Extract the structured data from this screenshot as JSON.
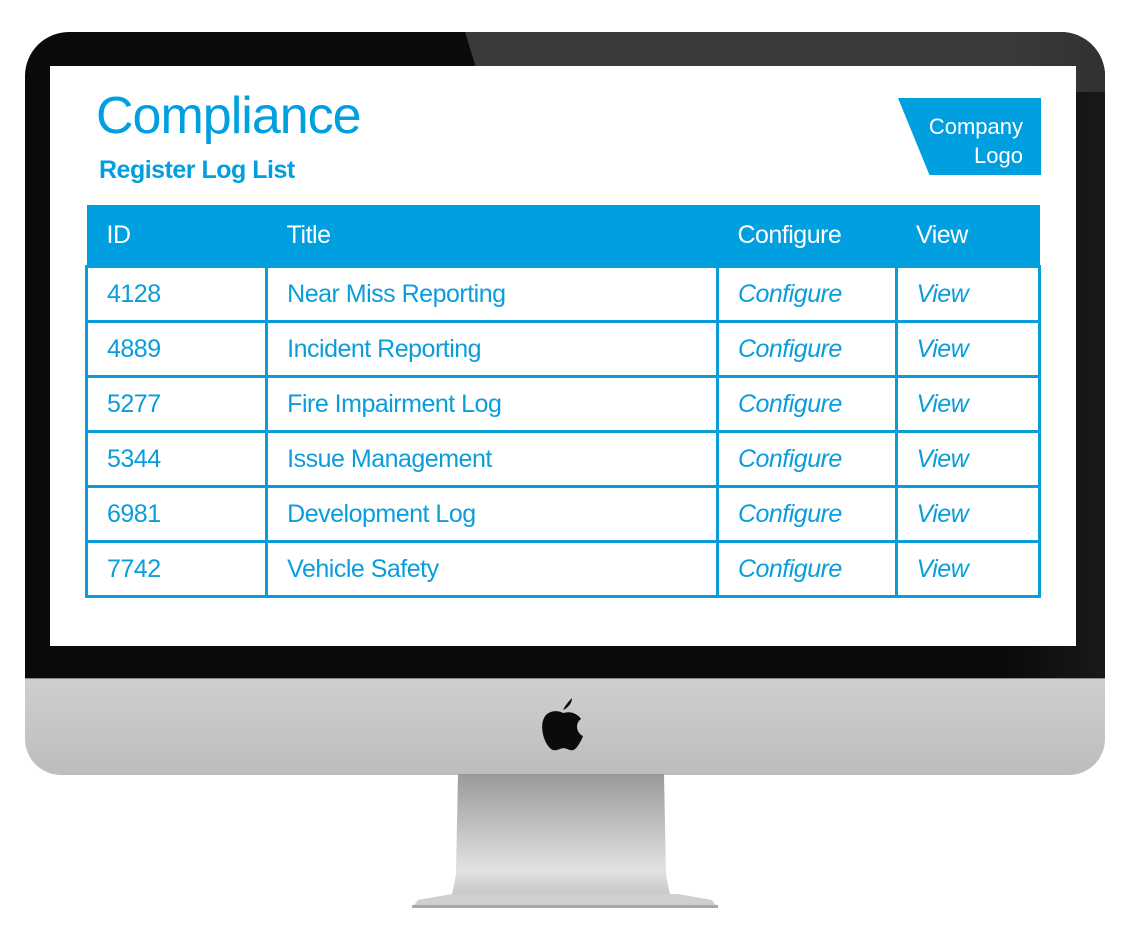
{
  "header": {
    "title": "Compliance",
    "subtitle": "Register Log List",
    "logo_line1": "Company",
    "logo_line2": "Logo"
  },
  "table": {
    "columns": [
      "ID",
      "Title",
      "Configure",
      "View"
    ],
    "rows": [
      {
        "id": "4128",
        "title": "Near Miss Reporting",
        "configure": "Configure",
        "view": "View"
      },
      {
        "id": "4889",
        "title": "Incident Reporting",
        "configure": "Configure",
        "view": "View"
      },
      {
        "id": "5277",
        "title": "Fire Impairment Log",
        "configure": "Configure",
        "view": "View"
      },
      {
        "id": "5344",
        "title": "Issue Management",
        "configure": "Configure",
        "view": "View"
      },
      {
        "id": "6981",
        "title": "Development Log",
        "configure": "Configure",
        "view": "View"
      },
      {
        "id": "7742",
        "title": "Vehicle Safety",
        "configure": "Configure",
        "view": "View"
      }
    ]
  },
  "colors": {
    "accent": "#009fe0",
    "bezel": "#0a0a0a",
    "chin": "#c8c8c8"
  },
  "device": {
    "brand_icon": "apple-logo-icon"
  }
}
